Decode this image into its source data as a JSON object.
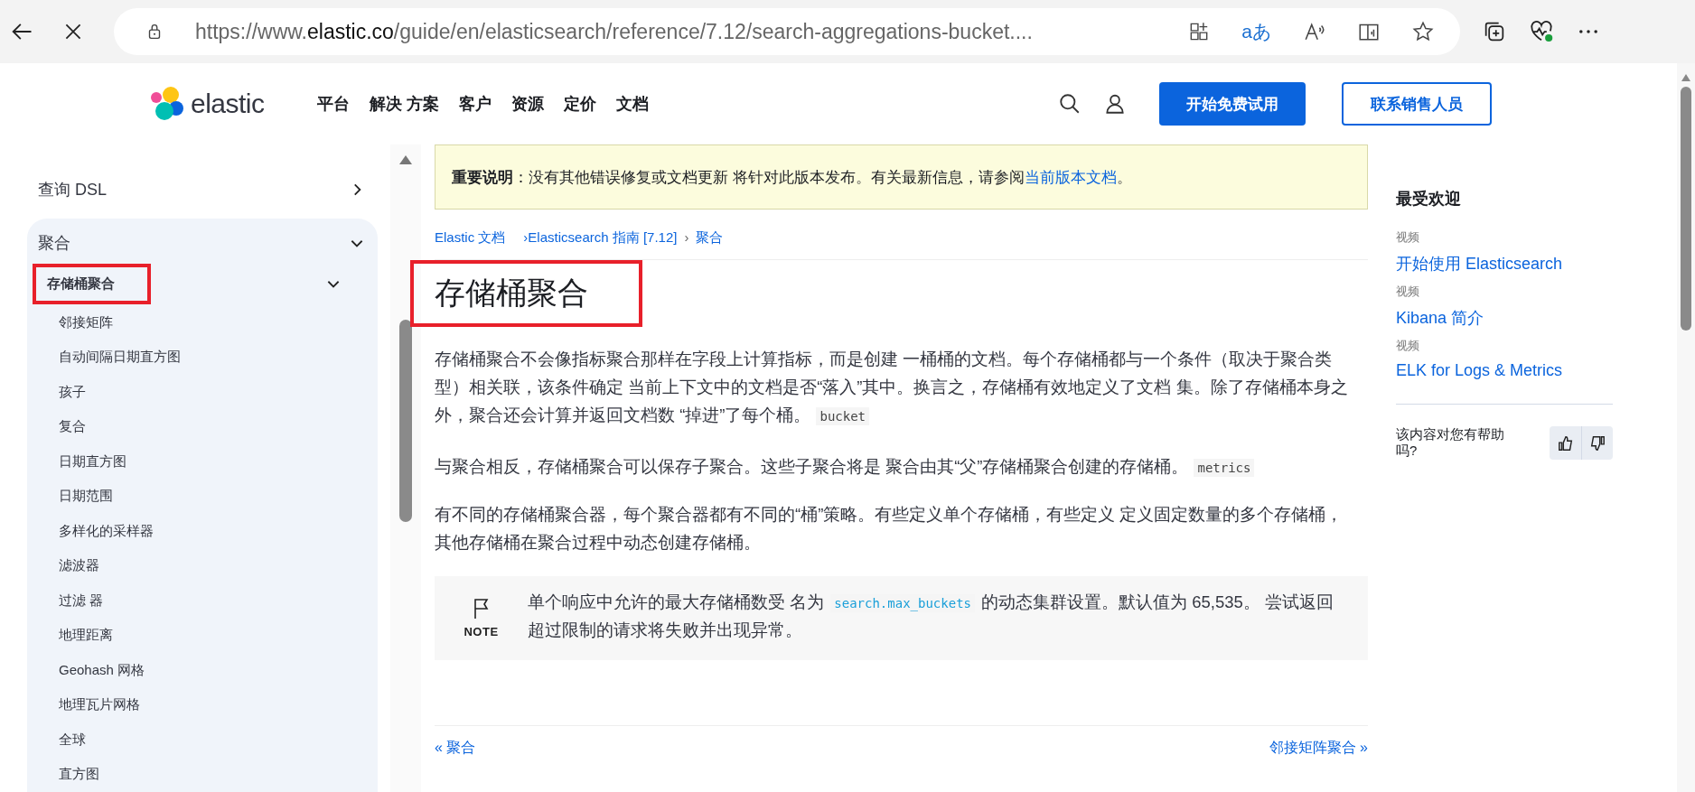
{
  "browser": {
    "url_prefix": "https://www.",
    "url_domain": "elastic.co",
    "url_path": "/guide/en/elasticsearch/reference/7.12/search-aggregations-bucket....",
    "translate_glyph": "aあ"
  },
  "header": {
    "logo_text": "elastic",
    "nav": [
      "平台",
      "解决 方案",
      "客户",
      "资源",
      "定价",
      "文档"
    ],
    "buttons": [
      {
        "label": "开始免费试用",
        "kind": "primary"
      },
      {
        "label": "联系销售人员",
        "kind": "secondary"
      }
    ]
  },
  "sidebar": {
    "items": [
      {
        "label": "查询 DSL",
        "expanded": false,
        "selected": false
      },
      {
        "label": "聚合",
        "expanded": true,
        "selected": false,
        "children": [
          {
            "label": "存储桶聚合",
            "expanded": true,
            "selected": true,
            "annotated": true,
            "children": [
              {
                "label": "邻接矩阵",
                "selected": false
              },
              {
                "label": "自动间隔日期直方图",
                "selected": false
              },
              {
                "label": "孩子",
                "selected": false
              },
              {
                "label": "复合",
                "selected": false
              },
              {
                "label": "日期直方图",
                "selected": false
              },
              {
                "label": "日期范围",
                "selected": false
              },
              {
                "label": "多样化的采样器",
                "selected": false
              },
              {
                "label": "滤波器",
                "selected": false
              },
              {
                "label": "过滤 器",
                "selected": false
              },
              {
                "label": "地理距离",
                "selected": false
              },
              {
                "label": "Geohash 网格",
                "selected": false
              },
              {
                "label": "地理瓦片网格",
                "selected": false
              },
              {
                "label": "全球",
                "selected": false
              },
              {
                "label": "直方图",
                "selected": false
              }
            ]
          }
        ]
      }
    ]
  },
  "notice": {
    "text": "**重要说明**：没有其他错误修复或文档更新 将针对此版本发布。有关最新信息，请参阅",
    "link": "当前版本文档",
    "text_after": "。"
  },
  "breadcrumbs": [
    "Elastic 文档",
    "›Elasticsearch 指南 [7.12]",
    "›",
    "聚合"
  ],
  "title": {
    "text": "存储桶聚合",
    "annotated": true
  },
  "paragraphs": [
    [
      {
        "kind": "text",
        "text": "存储桶聚合不会像指标聚合那样在字段上计算指标，而是创建 一桶桶的文档。每个存储桶都与一个条件（取决于聚合类型）相关联，该条件确定 当前上下文中的文档是否“落入”其中。换言之，存储桶有效地定义了文档 集。除了存储桶本身之外，聚合还会计算并返回文档数 “掉进”了每个桶。"
      },
      {
        "kind": "code",
        "text": "bucket"
      }
    ],
    [
      {
        "kind": "text",
        "text": "与聚合相反，存储桶聚合可以保存子聚合。这些子聚合将是 聚合由其“父”存储桶聚合创建的存储桶。"
      },
      {
        "kind": "code",
        "text": "metrics"
      }
    ],
    [
      {
        "kind": "text",
        "text": "有不同的存储桶聚合器，每个聚合器都有不同的“桶”策略。有些定义单个存储桶，有些定义 定义固定数量的多个存储桶，其他存储桶在聚合过程中动态创建存储桶。"
      }
    ]
  ],
  "note": {
    "label": "NOTE",
    "segments": [
      {
        "kind": "text",
        "text": "单个响应中允许的最大存储桶数受 名为 "
      },
      {
        "kind": "code",
        "text": "search.max_buckets"
      },
      {
        "kind": "text",
        "text": " 的动态集群设置。默认值为 65,535。 尝试返回超过限制的请求将失败并出现异常。"
      }
    ]
  },
  "page_nav": {
    "previous": "« 聚合",
    "next": "邻接矩阵聚合 »"
  },
  "popular": {
    "title": "最受欢迎",
    "items": [
      {
        "category": "视频",
        "link": "开始使用 Elasticsearch"
      },
      {
        "category": "视频",
        "link": "Kibana 简介"
      },
      {
        "category": "视频",
        "link": "ELK for Logs & Metrics"
      }
    ]
  },
  "feedback": {
    "question": "该内容对您有帮助吗?"
  }
}
